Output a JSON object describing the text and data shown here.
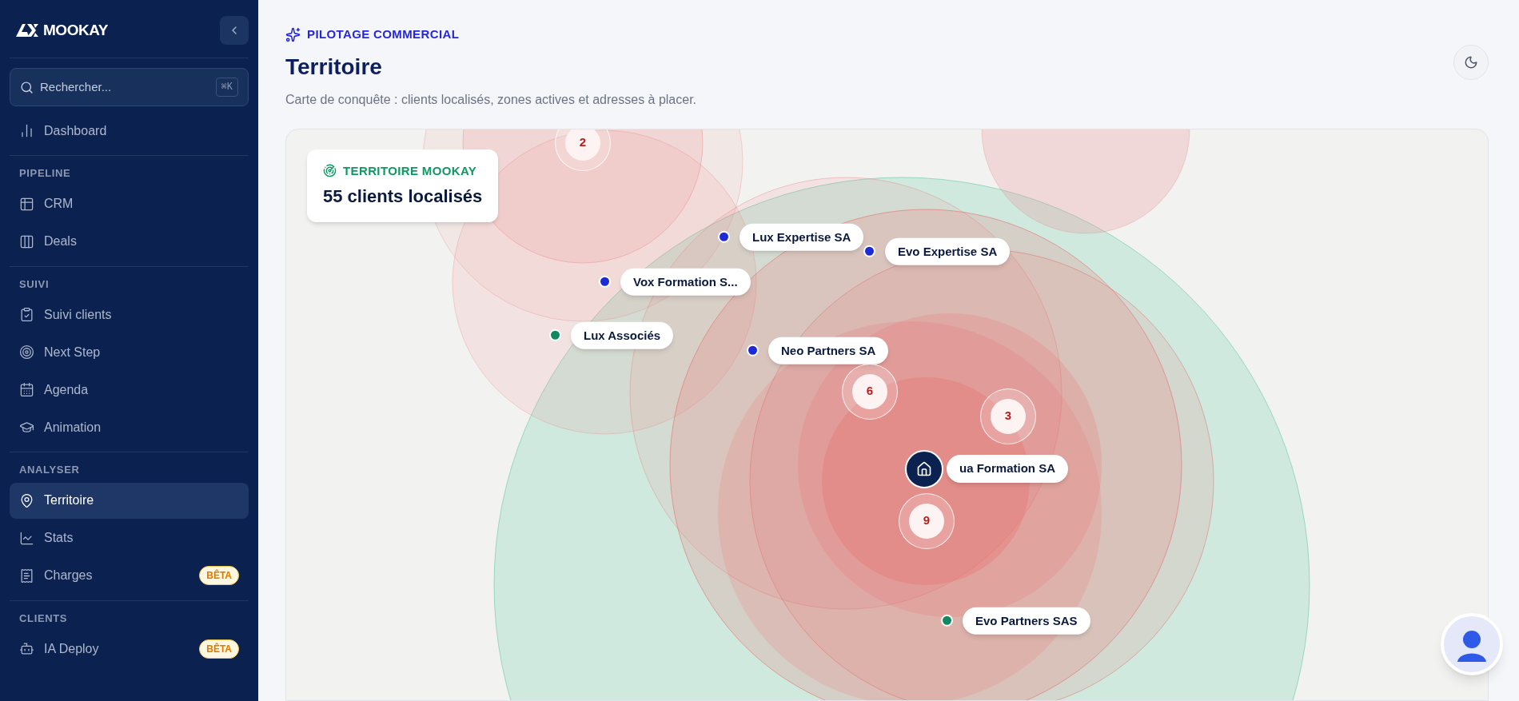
{
  "sidebar": {
    "logo": "MOOKAY",
    "search": {
      "placeholder": "Rechercher...",
      "shortcut": "⌘K"
    },
    "sections": [
      {
        "items": [
          {
            "label": "Dashboard",
            "selected": false
          }
        ]
      },
      {
        "title": "PIPELINE",
        "items": [
          {
            "label": "CRM",
            "selected": false
          },
          {
            "label": "Deals",
            "selected": false
          }
        ]
      },
      {
        "title": "SUIVI",
        "items": [
          {
            "label": "Suivi clients",
            "selected": false
          },
          {
            "label": "Next Step",
            "selected": false
          },
          {
            "label": "Agenda",
            "selected": false
          },
          {
            "label": "Animation",
            "selected": false
          }
        ]
      },
      {
        "title": "ANALYSER",
        "items": [
          {
            "label": "Territoire",
            "selected": true
          },
          {
            "label": "Stats",
            "selected": false
          },
          {
            "label": "Charges",
            "selected": false,
            "badge": "BÊTA"
          }
        ]
      },
      {
        "title": "CLIENTS",
        "items": [
          {
            "label": "IA Deploy",
            "selected": false,
            "badge": "BÊTA"
          }
        ]
      }
    ]
  },
  "header": {
    "eyebrow": "PILOTAGE COMMERCIAL",
    "title": "Territoire",
    "subtitle": "Carte de conquête : clients localisés, zones actives et adresses à placer."
  },
  "map": {
    "summary": {
      "label": "TERRITOIRE MOOKAY",
      "value": "55 clients localisés"
    },
    "markers": [
      {
        "kind": "cluster",
        "count": "2"
      },
      {
        "kind": "client",
        "label": "Lux Expertise SA",
        "color": "#1d2bd6"
      },
      {
        "kind": "client",
        "label": "Evo Expertise SA",
        "color": "#1d2bd6"
      },
      {
        "kind": "client",
        "label": "Vox Formation S...",
        "color": "#1d2bd6"
      },
      {
        "kind": "client",
        "label": "Lux Associés",
        "color": "#0f8a5f"
      },
      {
        "kind": "client",
        "label": "Neo Partners SA",
        "color": "#1d2bd6"
      },
      {
        "kind": "cluster",
        "count": "6"
      },
      {
        "kind": "cluster",
        "count": "3"
      },
      {
        "kind": "cluster",
        "count": "9"
      },
      {
        "kind": "home",
        "label": "ua Formation SA"
      },
      {
        "kind": "client",
        "label": "Evo Partners SAS",
        "color": "#0f8a5f"
      }
    ]
  }
}
